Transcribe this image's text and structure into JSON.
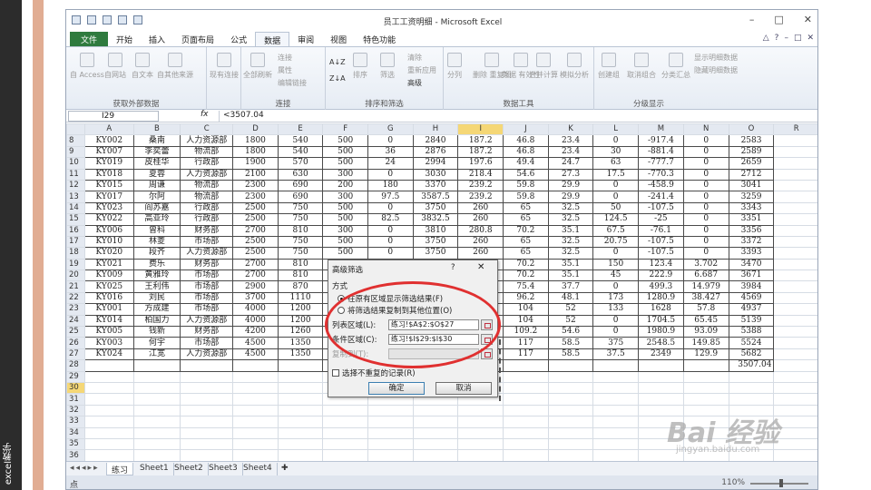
{
  "side_caption": "excel教学",
  "titlebar": {
    "title": "员工工资明细 - Microsoft Excel",
    "controls": [
      "–",
      "□",
      "✕"
    ]
  },
  "ribbon_tabs": [
    "文件",
    "开始",
    "插入",
    "页面布局",
    "公式",
    "数据",
    "审阅",
    "视图",
    "特色功能"
  ],
  "active_tab": "数据",
  "ribbon": {
    "get_external": {
      "label": "获取外部数据",
      "buttons": [
        "自 Access",
        "自网站",
        "自文本",
        "自其他来源",
        "现有连接"
      ]
    },
    "connections": {
      "label": "连接",
      "big": "全部刷新",
      "small": [
        "连接",
        "属性",
        "编辑链接"
      ]
    },
    "sort_filter": {
      "label": "排序和筛选",
      "buttons": [
        "排序",
        "筛选"
      ],
      "small": [
        "清除",
        "重新应用",
        "高级"
      ]
    },
    "data_tools": {
      "label": "数据工具",
      "buttons": [
        "分列",
        "删除\n重复项",
        "数据\n有效性",
        "合并计算",
        "模拟分析"
      ]
    },
    "outline": {
      "label": "分级显示",
      "buttons": [
        "创建组",
        "取消组合",
        "分类汇总"
      ],
      "small": [
        "显示明细数据",
        "隐藏明细数据"
      ]
    }
  },
  "formula_bar": {
    "name_box": "I29",
    "fx": "fx",
    "formula": "<3507.04"
  },
  "sheet": {
    "columns": [
      "A",
      "B",
      "C",
      "D",
      "E",
      "F",
      "G",
      "H",
      "I",
      "J",
      "K",
      "L",
      "M",
      "N",
      "O",
      "R"
    ],
    "active_column": "I",
    "active_row": "30",
    "rows": [
      {
        "n": "8",
        "cells": [
          "KY002",
          "桑南",
          "人力资源部",
          "1800",
          "540",
          "500",
          "0",
          "2840",
          "187.2",
          "46.8",
          "23.4",
          "0",
          "-917.4",
          "0",
          "2583"
        ]
      },
      {
        "n": "9",
        "cells": [
          "KY007",
          "李奕蕾",
          "物流部",
          "1800",
          "540",
          "500",
          "36",
          "2876",
          "187.2",
          "46.8",
          "23.4",
          "30",
          "-881.4",
          "0",
          "2589"
        ]
      },
      {
        "n": "10",
        "cells": [
          "KY019",
          "皮桂华",
          "行政部",
          "1900",
          "570",
          "500",
          "24",
          "2994",
          "197.6",
          "49.4",
          "24.7",
          "63",
          "-777.7",
          "0",
          "2659"
        ]
      },
      {
        "n": "11",
        "cells": [
          "KY018",
          "夏蓉",
          "人力资源部",
          "2100",
          "630",
          "300",
          "0",
          "3030",
          "218.4",
          "54.6",
          "27.3",
          "17.5",
          "-770.3",
          "0",
          "2712"
        ]
      },
      {
        "n": "12",
        "cells": [
          "KY015",
          "周谦",
          "物流部",
          "2300",
          "690",
          "200",
          "180",
          "3370",
          "239.2",
          "59.8",
          "29.9",
          "0",
          "-458.9",
          "0",
          "3041"
        ]
      },
      {
        "n": "13",
        "cells": [
          "KY017",
          "尔阿",
          "物流部",
          "2300",
          "690",
          "300",
          "97.5",
          "3587.5",
          "239.2",
          "59.8",
          "29.9",
          "0",
          "-241.4",
          "0",
          "3259"
        ]
      },
      {
        "n": "14",
        "cells": [
          "KY023",
          "阎苏嘉",
          "行政部",
          "2500",
          "750",
          "500",
          "0",
          "3750",
          "260",
          "65",
          "32.5",
          "50",
          "-107.5",
          "0",
          "3343"
        ]
      },
      {
        "n": "15",
        "cells": [
          "KY022",
          "高亚玲",
          "行政部",
          "2500",
          "750",
          "500",
          "82.5",
          "3832.5",
          "260",
          "65",
          "32.5",
          "124.5",
          "-25",
          "0",
          "3351"
        ]
      },
      {
        "n": "16",
        "cells": [
          "KY006",
          "曾科",
          "财务部",
          "2700",
          "810",
          "300",
          "0",
          "3810",
          "280.8",
          "70.2",
          "35.1",
          "67.5",
          "-76.1",
          "0",
          "3356"
        ]
      },
      {
        "n": "17",
        "cells": [
          "KY010",
          "林菱",
          "市场部",
          "2500",
          "750",
          "500",
          "0",
          "3750",
          "260",
          "65",
          "32.5",
          "20.75",
          "-107.5",
          "0",
          "3372"
        ]
      },
      {
        "n": "18",
        "cells": [
          "KY020",
          "段齐",
          "人力资源部",
          "2500",
          "750",
          "500",
          "0",
          "3750",
          "260",
          "65",
          "32.5",
          "0",
          "-107.5",
          "0",
          "3393"
        ]
      },
      {
        "n": "19",
        "cells": [
          "KY021",
          "费乐",
          "财务部",
          "2700",
          "810",
          "",
          "",
          "",
          "",
          "70.2",
          "35.1",
          "150",
          "123.4",
          "3.702",
          "3470"
        ]
      },
      {
        "n": "20",
        "cells": [
          "KY009",
          "黄雅玲",
          "市场部",
          "2700",
          "810",
          "",
          "",
          "",
          "",
          "70.2",
          "35.1",
          "45",
          "222.9",
          "6.687",
          "3671"
        ]
      },
      {
        "n": "21",
        "cells": [
          "KY025",
          "王利伟",
          "市场部",
          "2900",
          "870",
          "",
          "",
          "",
          "",
          "75.4",
          "37.7",
          "0",
          "499.3",
          "14.979",
          "3984"
        ]
      },
      {
        "n": "22",
        "cells": [
          "KY016",
          "刘民",
          "市场部",
          "3700",
          "1110",
          "",
          "",
          "",
          "",
          "96.2",
          "48.1",
          "173",
          "1280.9",
          "38.427",
          "4569"
        ]
      },
      {
        "n": "23",
        "cells": [
          "KY001",
          "方成建",
          "市场部",
          "4000",
          "1200",
          "",
          "",
          "",
          "",
          "104",
          "52",
          "133",
          "1628",
          "57.8",
          "4937"
        ]
      },
      {
        "n": "24",
        "cells": [
          "KY014",
          "柏国力",
          "人力资源部",
          "4000",
          "1200",
          "",
          "",
          "",
          "",
          "104",
          "52",
          "0",
          "1704.5",
          "65.45",
          "5139"
        ]
      },
      {
        "n": "25",
        "cells": [
          "KY005",
          "钱新",
          "财务部",
          "4200",
          "1260",
          "",
          "",
          "",
          "",
          "109.2",
          "54.6",
          "0",
          "1980.9",
          "93.09",
          "5388"
        ]
      },
      {
        "n": "26",
        "cells": [
          "KY003",
          "何宇",
          "市场部",
          "4500",
          "1350",
          "",
          "",
          "",
          "",
          "117",
          "58.5",
          "375",
          "2548.5",
          "149.85",
          "5524"
        ]
      },
      {
        "n": "27",
        "cells": [
          "KY024",
          "江宽",
          "人力资源部",
          "4500",
          "1350",
          "",
          "",
          "",
          "",
          "117",
          "58.5",
          "37.5",
          "2349",
          "129.9",
          "5682"
        ]
      },
      {
        "n": "28",
        "cells": [
          "",
          "",
          "",
          "",
          "",
          "",
          "",
          "",
          "",
          "",
          "",
          "",
          "",
          "",
          "3507.04"
        ]
      },
      {
        "n": "29",
        "cells": []
      },
      {
        "n": "30",
        "cells": []
      },
      {
        "n": "31",
        "cells": []
      },
      {
        "n": "32",
        "cells": []
      },
      {
        "n": "33",
        "cells": []
      },
      {
        "n": "34",
        "cells": []
      },
      {
        "n": "35",
        "cells": []
      },
      {
        "n": "36",
        "cells": []
      }
    ]
  },
  "sheet_tabs": [
    "练习",
    "Sheet1",
    "Sheet2",
    "Sheet3",
    "Sheet4"
  ],
  "active_sheet": "练习",
  "status": {
    "mode": "点",
    "zoom": "110%"
  },
  "dialog": {
    "title": "高级筛选",
    "help": "?",
    "close": "✕",
    "mode_label": "方式",
    "option1": "在原有区域显示筛选结果(F)",
    "option2": "将筛选结果复制到其他位置(O)",
    "list_range_label": "列表区域(L):",
    "list_range_value": "练习!$A$2:$O$27",
    "criteria_label": "条件区域(C):",
    "criteria_value": "练习!$I$29:$I$30",
    "copy_to_label": "复制到(T):",
    "copy_to_value": "",
    "unique_label": "选择不重复的记录(R)",
    "ok": "确定",
    "cancel": "取消"
  },
  "watermark": {
    "logo": "Bai 经验",
    "url": "jingyan.baidu.com"
  },
  "colors": {
    "file_tab": "#2f7b3e",
    "annotation_red": "#e03030",
    "active_header": "#f5d776"
  }
}
